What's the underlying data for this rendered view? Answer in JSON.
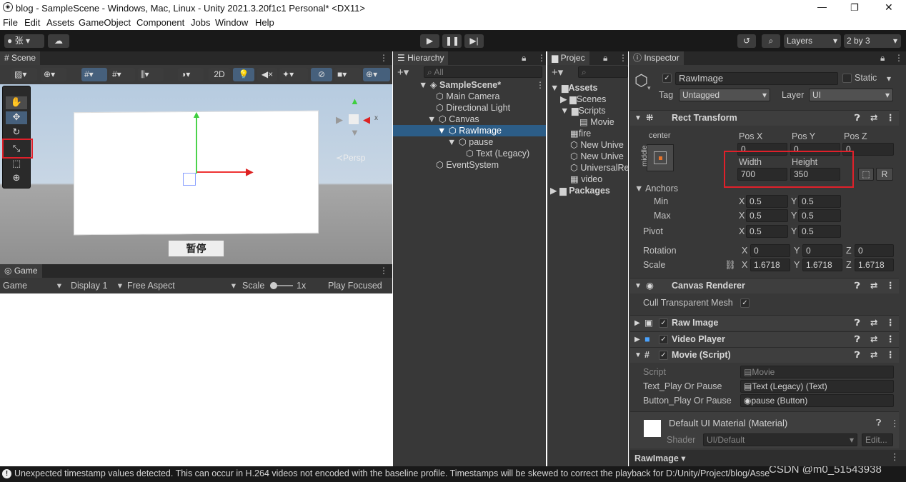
{
  "window": {
    "title": "blog - SampleScene - Windows, Mac, Linux - Unity 2021.3.20f1c1 Personal* <DX11>",
    "minimize": "—",
    "maximize": "❐",
    "close": "✕"
  },
  "menu": [
    "File",
    "Edit",
    "Assets",
    "GameObject",
    "Component",
    "Jobs",
    "Window",
    "Help"
  ],
  "toolbar": {
    "account": "张",
    "layers": "Layers",
    "layout": "2 by 3"
  },
  "scene": {
    "tab": "Scene",
    "mode_2d": "2D",
    "persp": "≺Persp",
    "pause_button": "暂停",
    "gizmo_x": "x"
  },
  "game": {
    "tab": "Game",
    "view": "Game",
    "display": "Display 1",
    "aspect": "Free Aspect",
    "scale_label": "Scale",
    "scale_value": "1x",
    "play_focused": "Play Focused"
  },
  "hierarchy": {
    "tab": "Hierarchy",
    "search": "All",
    "items": [
      {
        "label": "SampleScene*",
        "bold": true
      },
      {
        "label": "Main Camera"
      },
      {
        "label": "Directional Light"
      },
      {
        "label": "Canvas"
      },
      {
        "label": "RawImage",
        "selected": true
      },
      {
        "label": "pause"
      },
      {
        "label": "Text (Legacy)"
      },
      {
        "label": "EventSystem"
      }
    ]
  },
  "project": {
    "tab": "Projec",
    "items": [
      "Assets",
      "Scenes",
      "Scripts",
      "Movie",
      "fire",
      "New Unive",
      "New Unive",
      "UniversalRe",
      "video",
      "Packages"
    ]
  },
  "inspector": {
    "tab": "Inspector",
    "object_name": "RawImage",
    "static_label": "Static",
    "tag_label": "Tag",
    "tag_value": "Untagged",
    "layer_label": "Layer",
    "layer_value": "UI",
    "rect_transform": {
      "title": "Rect Transform",
      "anchor_label": "center",
      "side_label": "middle",
      "pos_x_label": "Pos X",
      "pos_y_label": "Pos Y",
      "pos_z_label": "Pos Z",
      "pos_x": "0",
      "pos_y": "0",
      "pos_z": "0",
      "width_label": "Width",
      "height_label": "Height",
      "width": "700",
      "height": "350",
      "r_button": "R",
      "anchors_label": "Anchors",
      "min_label": "Min",
      "max_label": "Max",
      "min_x": "0.5",
      "min_y": "0.5",
      "max_x": "0.5",
      "max_y": "0.5",
      "pivot_label": "Pivot",
      "pivot_x": "0.5",
      "pivot_y": "0.5",
      "rotation_label": "Rotation",
      "rot_x": "0",
      "rot_y": "0",
      "rot_z": "0",
      "scale_label": "Scale",
      "scale_x": "1.6718",
      "scale_y": "1.6718",
      "scale_z": "1.6718",
      "axis_x": "X",
      "axis_y": "Y",
      "axis_z": "Z"
    },
    "canvas_renderer": {
      "title": "Canvas Renderer",
      "cull_label": "Cull Transparent Mesh"
    },
    "raw_image": {
      "title": "Raw Image"
    },
    "video_player": {
      "title": "Video Player"
    },
    "movie_script": {
      "title": "Movie (Script)",
      "script_label": "Script",
      "script_value": "Movie",
      "text_label": "Text_Play Or Pause",
      "text_value": "Text (Legacy) (Text)",
      "button_label": "Button_Play Or Pause",
      "button_value": "pause (Button)"
    },
    "material": {
      "title": "Default UI Material (Material)",
      "shader_label": "Shader",
      "shader_value": "UI/Default",
      "edit": "Edit..."
    },
    "footer": "RawImage ▾"
  },
  "status": {
    "message": "Unexpected timestamp values detected. This can occur in H.264 videos not encoded with the baseline profile. Timestamps will be skewed to correct the playback for D:/Unity/Project/blog/Asse",
    "watermark": "CSDN @m0_51543938"
  }
}
